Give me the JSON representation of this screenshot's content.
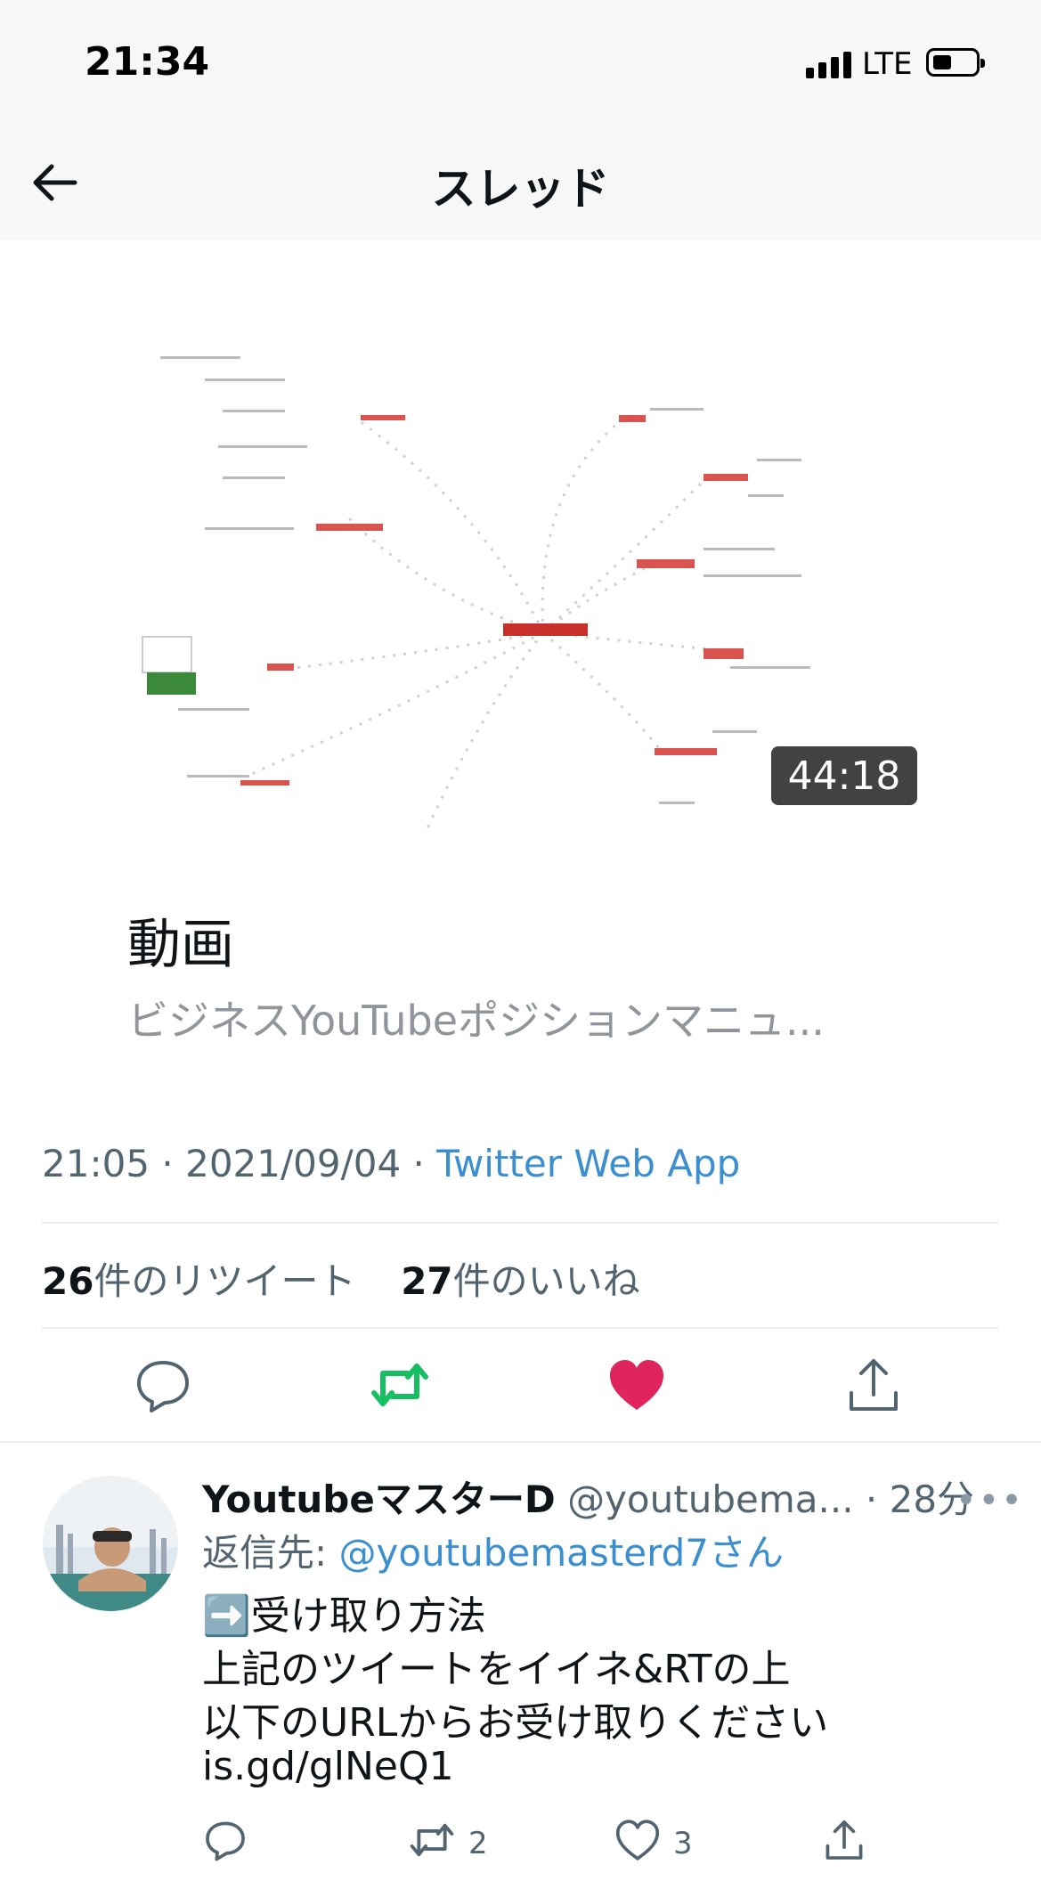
{
  "status_bar": {
    "time": "21:34",
    "network": "LTE"
  },
  "header": {
    "title": "スレッド",
    "back_icon": "back-arrow-icon"
  },
  "video_card": {
    "duration": "44:18",
    "title": "動画",
    "subtitle": "ビジネスYouTubeポジションマニュ..."
  },
  "tweet_meta": {
    "time": "21:05",
    "date": "2021/09/04",
    "separator": " · ",
    "source": "Twitter Web App"
  },
  "stats": {
    "retweets_count": "26",
    "retweets_label": "件のリツイート",
    "likes_count": "27",
    "likes_label": "件のいいね"
  },
  "actions": {
    "reply_icon": "reply-icon",
    "retweet_icon": "retweet-icon",
    "like_icon": "heart-filled-icon",
    "share_icon": "share-icon",
    "retweet_color": "#17bf63",
    "like_color": "#e0245e"
  },
  "reply": {
    "name": "YoutubeマスターD",
    "handle": "@youtubema...",
    "separator": " · ",
    "time": "28分",
    "reply_to_label": "返信先: ",
    "reply_to_handle": "@youtubemasterd7さん",
    "body_line1": "➡️受け取り方法",
    "body_line2": "上記のツイートをイイネ&RTの上",
    "body_line3": "以下のURLからお受け取りください",
    "link": "is.gd/glNeQ1",
    "retweets": "2",
    "likes": "3"
  }
}
